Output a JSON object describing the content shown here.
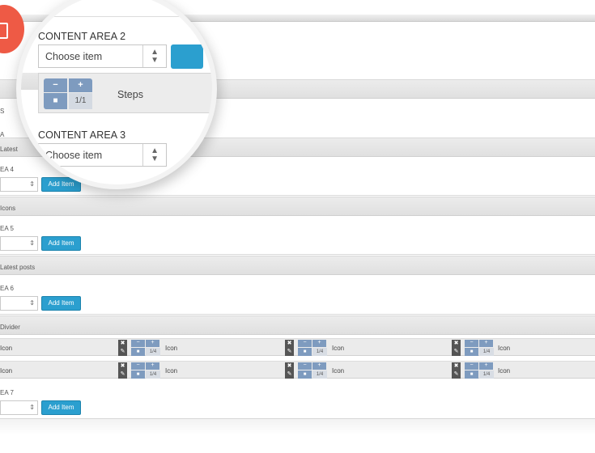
{
  "sections": [
    {
      "header": "",
      "area_label": "S",
      "area2": "A"
    },
    {
      "header": "Latest",
      "area_label": "EA 4"
    },
    {
      "header": "Icons",
      "area_label": "EA 5"
    },
    {
      "header": "Latest posts",
      "area_label": "EA 6"
    },
    {
      "header": "Divider",
      "area_label": "EA 7"
    }
  ],
  "add_item_label": "Add Item",
  "icon_rows": [
    {
      "label": "Icon",
      "count": "1/4"
    },
    {
      "label": "Icon",
      "count": "1/4"
    }
  ],
  "zoom": {
    "content_area_2": "CONTENT AREA 2",
    "content_area_3": "CONTENT AREA 3",
    "choose_item": "Choose item",
    "steps_label": "Steps",
    "steps_count": "1/1",
    "button_fragment": "A"
  },
  "colors": {
    "accent": "#2b9fcf",
    "stepper": "#7e9bbf",
    "brand_red": "#ee5a45"
  }
}
